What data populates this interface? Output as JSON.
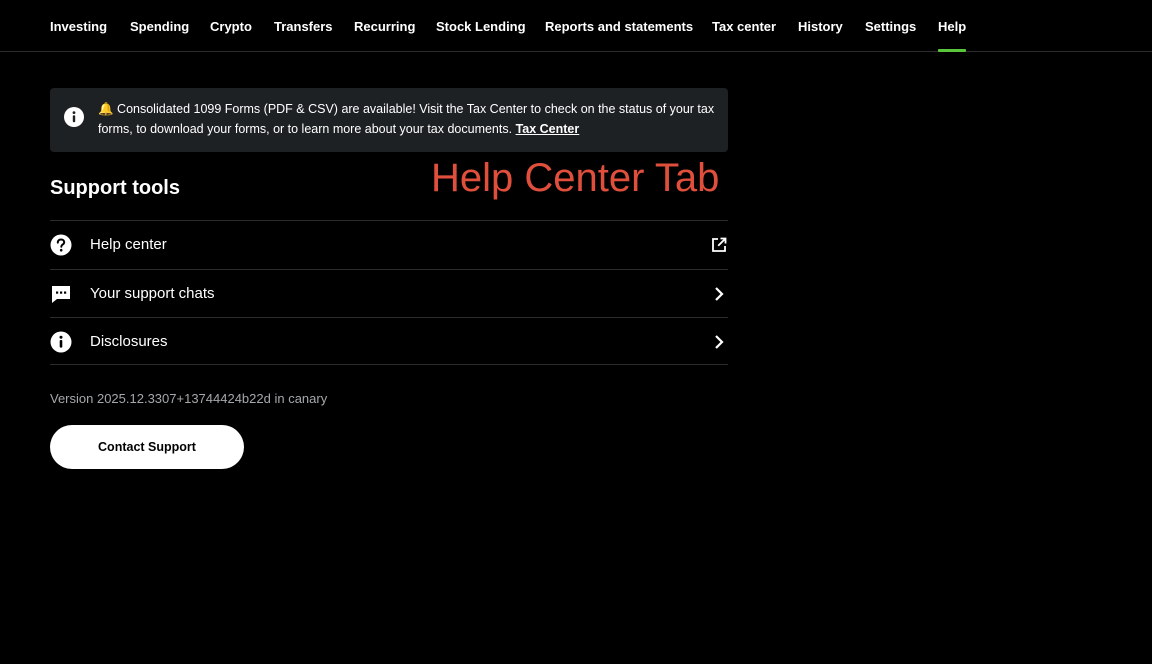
{
  "nav": {
    "items": [
      {
        "label": "Investing"
      },
      {
        "label": "Spending"
      },
      {
        "label": "Crypto"
      },
      {
        "label": "Transfers"
      },
      {
        "label": "Recurring"
      },
      {
        "label": "Stock Lending"
      },
      {
        "label": "Reports and statements"
      },
      {
        "label": "Tax center"
      },
      {
        "label": "History"
      },
      {
        "label": "Settings"
      },
      {
        "label": "Help"
      }
    ],
    "active": "Help"
  },
  "banner": {
    "icon": "info-icon",
    "emoji": "🔔",
    "text": " Consolidated 1099 Forms (PDF & CSV) are available! Visit the Tax Center to check on the status of your tax forms, to download your forms, or to learn more about your tax documents. ",
    "link_label": "Tax Center"
  },
  "annotation": "Help Center Tab",
  "support": {
    "title": "Support tools",
    "items": [
      {
        "label": "Help center",
        "icon": "question-circle-icon",
        "trail_icon": "external-link-icon"
      },
      {
        "label": "Your support chats",
        "icon": "chat-bubble-icon",
        "trail_icon": "chevron-right-icon"
      },
      {
        "label": "Disclosures",
        "icon": "info-icon",
        "trail_icon": "chevron-right-icon"
      }
    ]
  },
  "version": "Version 2025.12.3307+13744424b22d in canary",
  "contact_button_label": "Contact Support",
  "colors": {
    "background": "#000000",
    "accent": "#5ac53b",
    "banner_bg": "#1e2124",
    "annotation": "#e04f3c",
    "muted_text": "#a5a8ab"
  }
}
